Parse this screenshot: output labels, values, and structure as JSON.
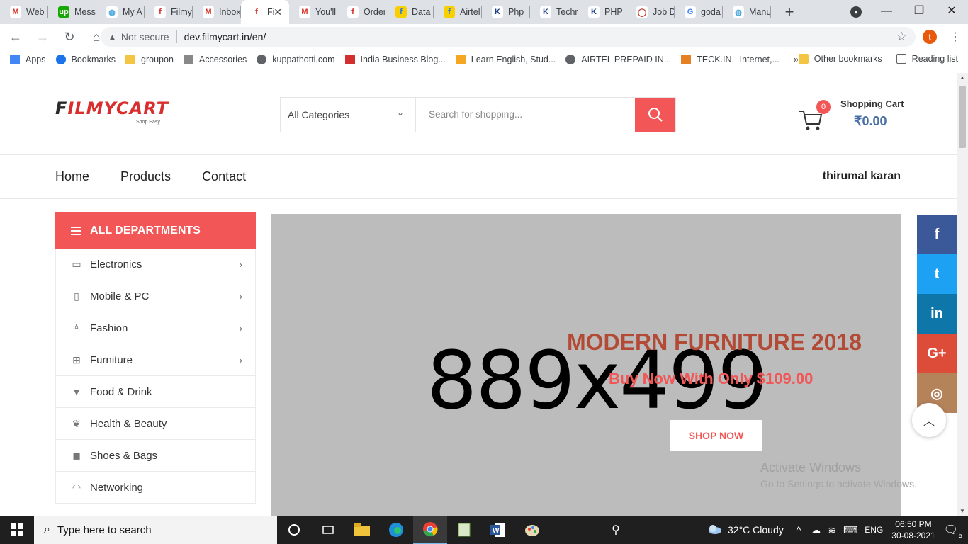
{
  "browser": {
    "tabs": [
      {
        "label": "Web",
        "icon": "gmail-icon"
      },
      {
        "label": "Mess",
        "icon": "upwork-icon"
      },
      {
        "label": "My A",
        "icon": "globe-icon"
      },
      {
        "label": "Filmy",
        "icon": "filmycart-icon"
      },
      {
        "label": "Inbox",
        "icon": "gmail-icon"
      },
      {
        "label": "Fi",
        "icon": "filmycart-icon",
        "active": true
      },
      {
        "label": "You'll",
        "icon": "gmail-icon"
      },
      {
        "label": "Order",
        "icon": "filmycart-icon"
      },
      {
        "label": "Data",
        "icon": "flipkart-icon"
      },
      {
        "label": "Airtel",
        "icon": "flipkart-icon"
      },
      {
        "label": "Php",
        "icon": "k-icon"
      },
      {
        "label": "Techr",
        "icon": "k-icon"
      },
      {
        "label": "PHP",
        "icon": "k-icon"
      },
      {
        "label": "Job D",
        "icon": "circle-icon"
      },
      {
        "label": "goda",
        "icon": "google-icon"
      },
      {
        "label": "Manu",
        "icon": "globe-icon"
      }
    ],
    "address": {
      "security": "Not secure",
      "url": "dev.filmycart.in/en/"
    },
    "profile_initial": "t",
    "bookmarks": [
      {
        "label": "Apps",
        "icon": "apps-icon",
        "color": "#4285f4"
      },
      {
        "label": "Bookmarks",
        "icon": "star-icon",
        "color": "#1a73e8"
      },
      {
        "label": "groupon",
        "icon": "folder-icon",
        "color": "#f4c542"
      },
      {
        "label": "Accessories",
        "icon": "max-icon",
        "color": "#888888"
      },
      {
        "label": "kuppathotti.com",
        "icon": "globe-icon",
        "color": "#5f6368"
      },
      {
        "label": "India Business Blog...",
        "icon": "ti-icon",
        "color": "#d32f2f"
      },
      {
        "label": "Learn English, Stud...",
        "icon": "play-icon",
        "color": "#f5a623"
      },
      {
        "label": "AIRTEL PREPAID IN...",
        "icon": "globe-icon",
        "color": "#5f6368"
      },
      {
        "label": "TECK.IN - Internet,...",
        "icon": "teck-icon",
        "color": "#e67e22"
      }
    ],
    "bookmarks_more": "»",
    "other_bookmarks": "Other bookmarks",
    "reading_list": "Reading list"
  },
  "site": {
    "logo_f": "F",
    "logo_rest": "ILMYCART",
    "logo_tag": "Shop Easy",
    "search": {
      "category": "All Categories",
      "placeholder": "Search for shopping..."
    },
    "cart": {
      "count": "0",
      "label": "Shopping Cart",
      "amount": "₹0.00"
    },
    "nav": [
      "Home",
      "Products",
      "Contact"
    ],
    "user": "thirumal karan",
    "departments": {
      "heading": "ALL DEPARTMENTS",
      "items": [
        {
          "label": "Electronics",
          "icon": "monitor-icon",
          "has_sub": true
        },
        {
          "label": "Mobile & PC",
          "icon": "tablet-icon",
          "has_sub": true
        },
        {
          "label": "Fashion",
          "icon": "person-icon",
          "has_sub": true
        },
        {
          "label": "Furniture",
          "icon": "furniture-icon",
          "has_sub": true
        },
        {
          "label": "Food & Drink",
          "icon": "glass-icon",
          "has_sub": false
        },
        {
          "label": "Health & Beauty",
          "icon": "leaf-icon",
          "has_sub": false
        },
        {
          "label": "Shoes & Bags",
          "icon": "bag-icon",
          "has_sub": false
        },
        {
          "label": "Networking",
          "icon": "wifi-icon",
          "has_sub": false
        }
      ]
    },
    "banner": {
      "placeholder": "889x499",
      "title": "MODERN FURNITURE 2018",
      "subtitle": "Buy Now With Only $109.00",
      "cta": "SHOP NOW"
    },
    "social": [
      {
        "name": "facebook-icon",
        "glyph": "f",
        "color": "#3b5998"
      },
      {
        "name": "twitter-icon",
        "glyph": "t",
        "color": "#1da1f2"
      },
      {
        "name": "linkedin-icon",
        "glyph": "in",
        "color": "#0e76a8"
      },
      {
        "name": "google-plus-icon",
        "glyph": "G+",
        "color": "#dd4b39"
      },
      {
        "name": "instagram-icon",
        "glyph": "◎",
        "color": "#b5835a"
      }
    ]
  },
  "watermark": {
    "line1": "Activate Windows",
    "line2": "Go to Settings to activate Windows."
  },
  "taskbar": {
    "search_placeholder": "Type here to search",
    "weather": "32°C  Cloudy",
    "language": "ENG",
    "time": "06:50 PM",
    "date": "30-08-2021",
    "notifications": "5"
  }
}
